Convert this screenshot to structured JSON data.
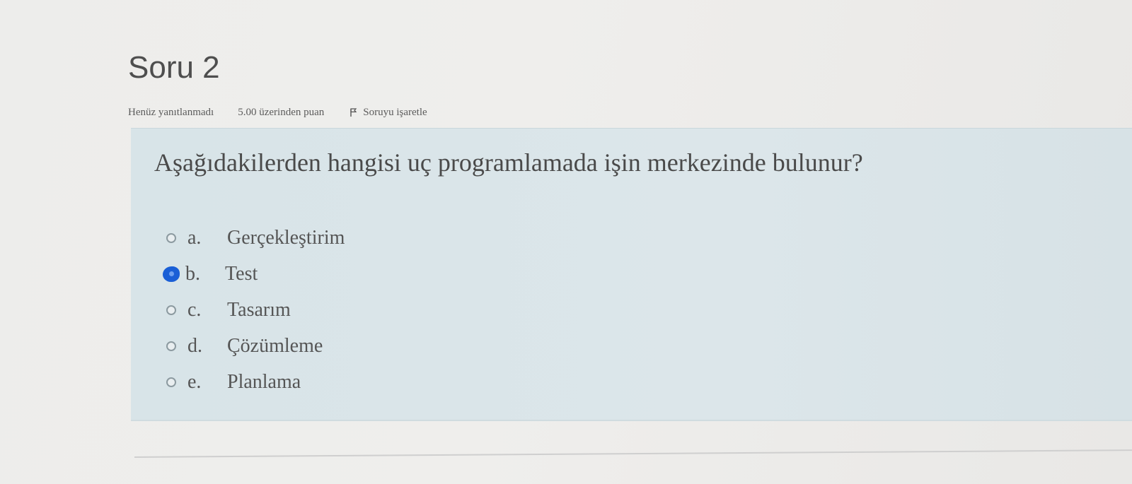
{
  "question": {
    "title": "Soru 2",
    "state": "Henüz yanıtlanmadı",
    "grade": "5.00 üzerinden puan",
    "flag_label": "Soruyu işaretle",
    "flag_icon": "flag-icon",
    "text": "Aşağıdakilerden hangisi uç programlamada işin merkezinde bulunur?",
    "answers": [
      {
        "letter": "a.",
        "label": "Gerçekleştirim",
        "selected": false
      },
      {
        "letter": "b.",
        "label": "Test",
        "selected": true
      },
      {
        "letter": "c.",
        "label": "Tasarım",
        "selected": false
      },
      {
        "letter": "d.",
        "label": "Çözümleme",
        "selected": false
      },
      {
        "letter": "e.",
        "label": "Planlama",
        "selected": false
      }
    ]
  },
  "colors": {
    "selected_radio": "#1a5fd6",
    "question_box": "#dce6ea"
  }
}
